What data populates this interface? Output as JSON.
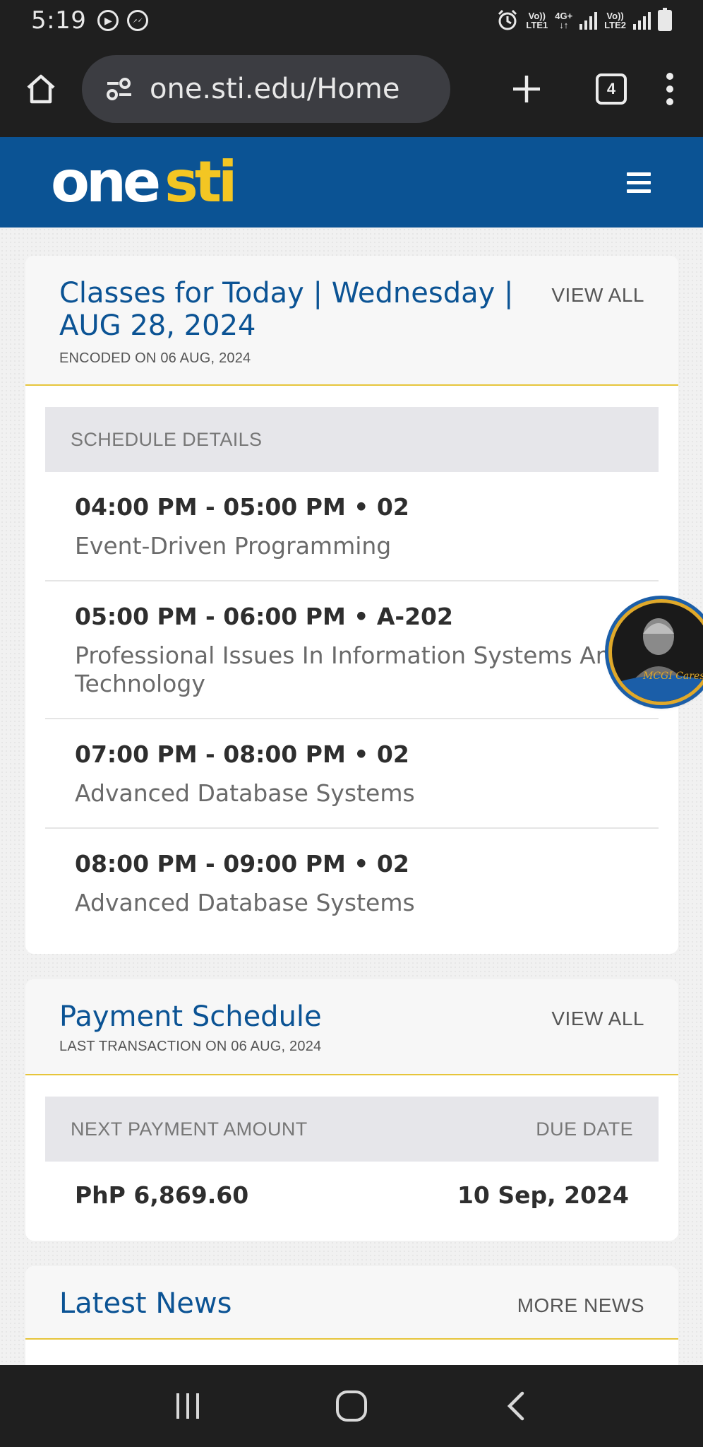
{
  "status_bar": {
    "time": "5:19",
    "net1": {
      "top": "Vo))",
      "bottom": "LTE1"
    },
    "net_gen": {
      "top": "4G+",
      "bottom": "↓↑"
    },
    "net2": {
      "top": "Vo))",
      "bottom": "LTE2"
    }
  },
  "browser": {
    "url": "one.sti.edu/Home",
    "tab_count": "4"
  },
  "site": {
    "logo_one": "one",
    "logo_sti": "sti"
  },
  "classes_card": {
    "title": "Classes for Today | Wednesday | AUG 28, 2024",
    "subtitle": "ENCODED ON 06 AUG, 2024",
    "view_all": "VIEW ALL",
    "table_header": "SCHEDULE DETAILS",
    "rows": [
      {
        "time": "04:00 PM - 05:00 PM • 02",
        "subject": "Event-Driven Programming"
      },
      {
        "time": "05:00 PM - 06:00 PM • A-202",
        "subject": "Professional Issues In Information Systems And Technology"
      },
      {
        "time": "07:00 PM - 08:00 PM • 02",
        "subject": "Advanced Database Systems"
      },
      {
        "time": "08:00 PM - 09:00 PM • 02",
        "subject": "Advanced Database Systems"
      }
    ]
  },
  "payment_card": {
    "title": "Payment Schedule",
    "subtitle": "LAST TRANSACTION ON 06 AUG, 2024",
    "view_all": "VIEW ALL",
    "col_amount": "NEXT PAYMENT AMOUNT",
    "col_due": "DUE DATE",
    "amount": "PhP 6,869.60",
    "due_date": "10 Sep, 2024"
  },
  "news_card": {
    "title": "Latest News",
    "more": "MORE NEWS"
  },
  "badge": {
    "text": "MCGI Cares"
  },
  "colors": {
    "brand_blue": "#0b5394",
    "brand_yellow": "#f3c623",
    "divider_gold": "#e6c53b"
  }
}
